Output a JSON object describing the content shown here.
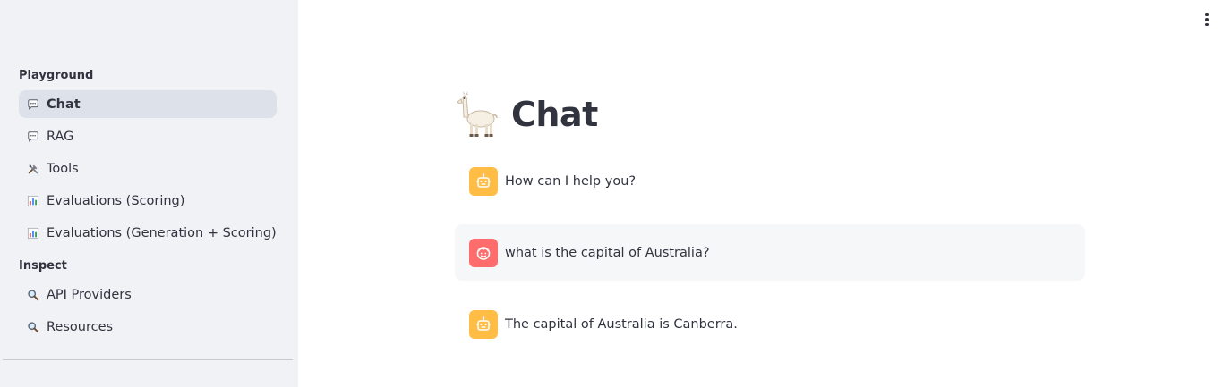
{
  "sidebar": {
    "sections": [
      {
        "title": "Playground",
        "items": [
          {
            "icon": "speech-balloon-icon",
            "label": "Chat",
            "active": true
          },
          {
            "icon": "speech-balloon-icon",
            "label": "RAG",
            "active": false
          },
          {
            "icon": "tools-icon",
            "label": "Tools",
            "active": false
          },
          {
            "icon": "bar-chart-icon",
            "label": "Evaluations (Scoring)",
            "active": false
          },
          {
            "icon": "bar-chart-icon",
            "label": "Evaluations (Generation + Scoring)",
            "active": false
          }
        ]
      },
      {
        "title": "Inspect",
        "items": [
          {
            "icon": "magnifier-icon",
            "label": "API Providers",
            "active": false
          },
          {
            "icon": "magnifier-icon",
            "label": "Resources",
            "active": false
          }
        ]
      }
    ]
  },
  "main": {
    "title_icon": "llama-icon",
    "title": "Chat",
    "menu_icon": "vertical-ellipsis-icon",
    "messages": [
      {
        "role": "assistant",
        "avatar": "robot-face-icon",
        "text": "How can I help you?"
      },
      {
        "role": "user",
        "avatar": "smiling-face-icon",
        "text": "what is the capital of Australia?"
      },
      {
        "role": "assistant",
        "avatar": "robot-face-icon",
        "text": "The capital of Australia is Canberra."
      }
    ]
  },
  "colors": {
    "sidebar_bg": "#f0f2f6",
    "active_item_bg": "#dde1ea",
    "assistant_avatar": "#ffbd45",
    "user_avatar": "#ff6c6c",
    "user_message_bg": "#f6f7f9",
    "text": "#31333f"
  }
}
